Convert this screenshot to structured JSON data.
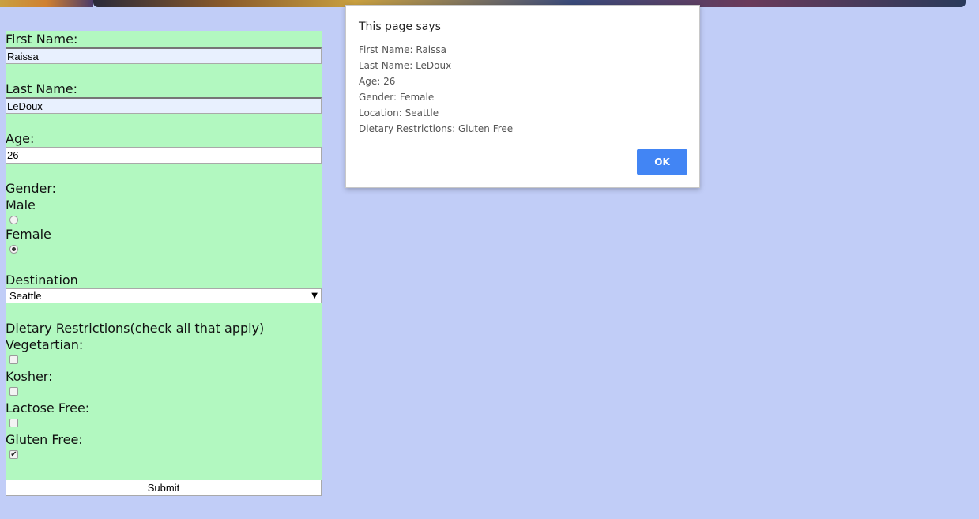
{
  "form": {
    "first_name_label": "First Name:",
    "first_name_value": "Raissa",
    "last_name_label": "Last Name:",
    "last_name_value": "LeDoux",
    "age_label": "Age:",
    "age_value": "26",
    "gender_label": "Gender:",
    "gender_male_label": "Male",
    "gender_female_label": "Female",
    "gender_selected": "Female",
    "destination_label": "Destination",
    "destination_selected": "Seattle",
    "dietary_label": "Dietary Restrictions(check all that apply)",
    "diet_options": [
      {
        "label": "Vegetartian:",
        "checked": false
      },
      {
        "label": "Kosher:",
        "checked": false
      },
      {
        "label": "Lactose Free:",
        "checked": false
      },
      {
        "label": "Gluten Free:",
        "checked": true
      }
    ],
    "submit_label": "Submit"
  },
  "dialog": {
    "title": "This page says",
    "lines": [
      "First Name: Raissa",
      "Last Name: LeDoux",
      "Age: 26",
      "Gender: Female",
      "Location: Seattle",
      "Dietary Restrictions: Gluten Free"
    ],
    "ok_label": "OK"
  },
  "colors": {
    "page_bg": "#c1cdf7",
    "form_bg": "#b2f8c0",
    "ok_button": "#4285f4"
  }
}
